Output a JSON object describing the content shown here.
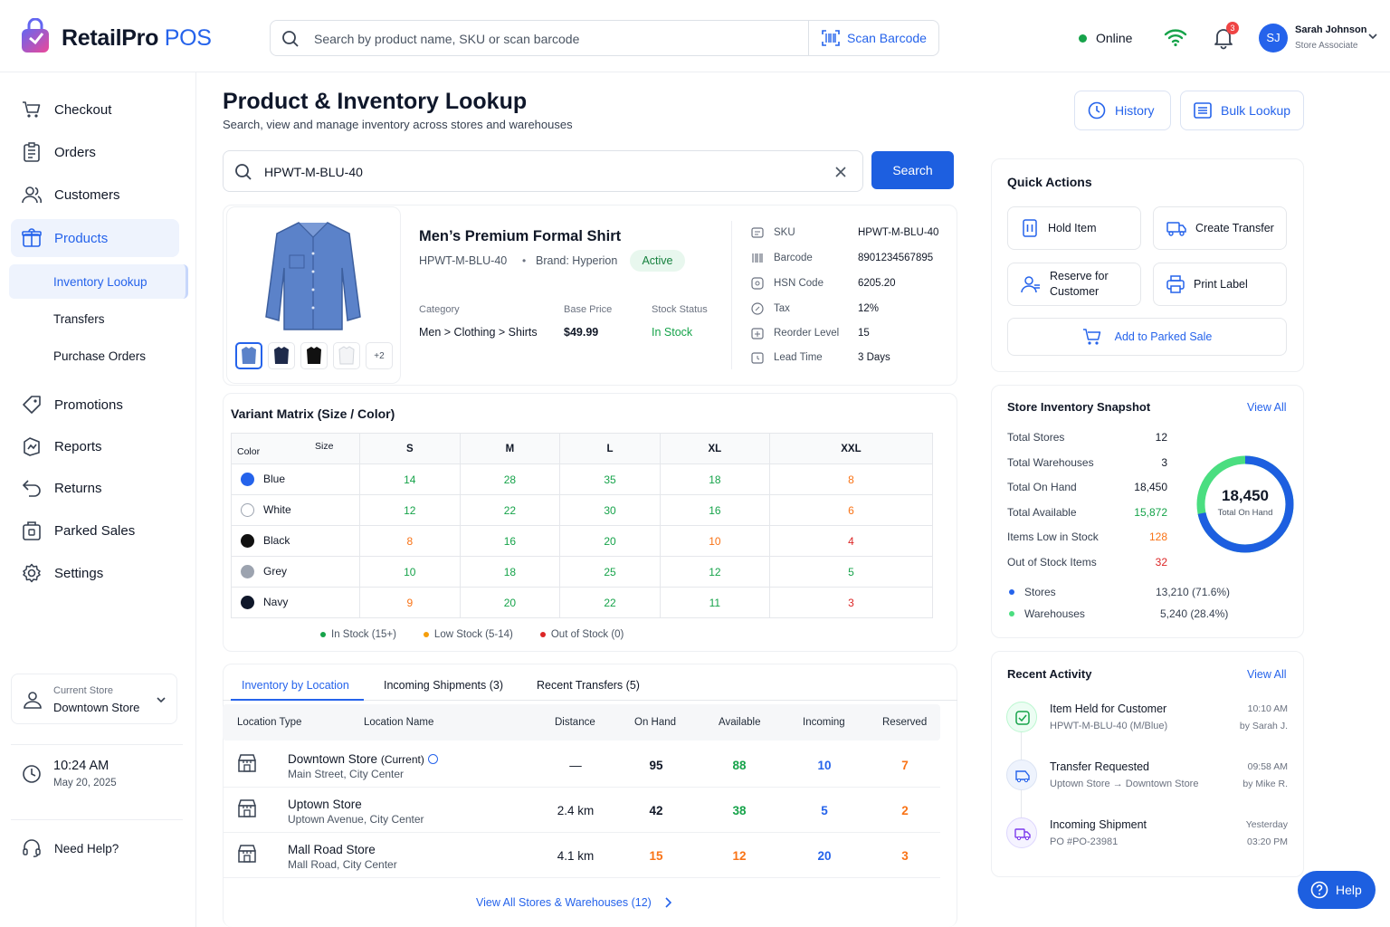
{
  "app": {
    "name": "RetailPro",
    "suffix": "POS"
  },
  "header": {
    "search_placeholder": "Search by product name, SKU or scan barcode",
    "scan_label": "Scan Barcode",
    "status": "Online",
    "notifications": "3",
    "user": {
      "initials": "SJ",
      "name": "Sarah Johnson",
      "role": "Store Associate"
    }
  },
  "sidebar": {
    "items": [
      {
        "label": "Checkout",
        "icon": "cart-icon"
      },
      {
        "label": "Orders",
        "icon": "clipboard-icon"
      },
      {
        "label": "Customers",
        "icon": "users-icon"
      },
      {
        "label": "Products",
        "icon": "box-icon"
      },
      {
        "label": "Promotions",
        "icon": "tag-icon"
      },
      {
        "label": "Reports",
        "icon": "chart-icon"
      },
      {
        "label": "Returns",
        "icon": "return-icon"
      },
      {
        "label": "Parked Sales",
        "icon": "parked-icon"
      },
      {
        "label": "Settings",
        "icon": "gear-icon"
      }
    ],
    "sub_items": [
      "Inventory Lookup",
      "Transfers",
      "Purchase Orders"
    ],
    "current_store_label": "Current Store",
    "current_store": "Downtown Store",
    "time": "10:24 AM",
    "date": "May 20, 2025",
    "help": "Need Help?"
  },
  "page": {
    "title": "Product & Inventory Lookup",
    "subtitle": "Search, view and manage inventory across stores and warehouses",
    "history": "History",
    "bulk": "Bulk Lookup",
    "search_value": "HPWT-M-BLU-40",
    "search_button": "Search"
  },
  "product": {
    "name": "Men’s Premium Formal Shirt",
    "sku": "HPWT-M-BLU-40",
    "brand": "Brand: Hyperion",
    "status": "Active",
    "more_images": "+2",
    "category_label": "Category",
    "category": "Men > Clothing > Shirts",
    "price_label": "Base Price",
    "price": "$49.99",
    "stock_label": "Stock Status",
    "stock": "In Stock",
    "details": [
      {
        "label": "SKU",
        "value": "HPWT-M-BLU-40"
      },
      {
        "label": "Barcode",
        "value": "8901234567895"
      },
      {
        "label": "HSN Code",
        "value": "6205.20"
      },
      {
        "label": "Tax",
        "value": "12%"
      },
      {
        "label": "Reorder Level",
        "value": "15"
      },
      {
        "label": "Lead Time",
        "value": "3 Days"
      }
    ]
  },
  "matrix": {
    "title": "Variant Matrix (Size / Color)",
    "size_label": "Size",
    "color_label": "Color",
    "sizes": [
      "S",
      "M",
      "L",
      "XL",
      "XXL"
    ],
    "rows": [
      {
        "color": "Blue",
        "hex": "#2563eb",
        "values": [
          "14",
          "28",
          "35",
          "18",
          "8"
        ],
        "levels": [
          "g",
          "g",
          "g",
          "g",
          "o"
        ]
      },
      {
        "color": "White",
        "hex": "#ffffff",
        "values": [
          "12",
          "22",
          "30",
          "16",
          "6"
        ],
        "levels": [
          "g",
          "g",
          "g",
          "g",
          "o"
        ]
      },
      {
        "color": "Black",
        "hex": "#111111",
        "values": [
          "8",
          "16",
          "20",
          "10",
          "4"
        ],
        "levels": [
          "o",
          "g",
          "g",
          "o",
          "r"
        ]
      },
      {
        "color": "Grey",
        "hex": "#9ca3af",
        "values": [
          "10",
          "18",
          "25",
          "12",
          "5"
        ],
        "levels": [
          "g",
          "g",
          "g",
          "g",
          "g"
        ]
      },
      {
        "color": "Navy",
        "hex": "#0f172a",
        "values": [
          "9",
          "20",
          "22",
          "11",
          "3"
        ],
        "levels": [
          "o",
          "g",
          "g",
          "g",
          "r"
        ]
      }
    ],
    "legend": [
      "In Stock (15+)",
      "Low Stock (5-14)",
      "Out of Stock (0)"
    ]
  },
  "tabs": [
    "Inventory by Location",
    "Incoming Shipments (3)",
    "Recent Transfers (5)"
  ],
  "locations": {
    "headers": [
      "Location Type",
      "Location Name",
      "Distance",
      "On Hand",
      "Available",
      "Incoming",
      "Reserved"
    ],
    "rows": [
      {
        "name": "Downtown Store",
        "tag": "(Current)",
        "address": "Main Street, City Center",
        "distance": "—",
        "on_hand": "95",
        "available": "88",
        "incoming": "10",
        "reserved": "7"
      },
      {
        "name": "Uptown Store",
        "tag": "",
        "address": "Uptown Avenue, City Center",
        "distance": "2.4 km",
        "on_hand": "42",
        "available": "38",
        "incoming": "5",
        "reserved": "2"
      },
      {
        "name": "Mall Road Store",
        "tag": "",
        "address": "Mall Road, City Center",
        "distance": "4.1 km",
        "on_hand": "15",
        "available": "12",
        "incoming": "20",
        "reserved": "3"
      }
    ],
    "view_all": "View All Stores & Warehouses (12)"
  },
  "quick_actions": {
    "title": "Quick Actions",
    "items": [
      "Hold Item",
      "Create Transfer",
      "Reserve for Customer",
      "Print Label"
    ],
    "parked": "Add to Parked Sale"
  },
  "snapshot": {
    "title": "Store Inventory Snapshot",
    "view_all": "View All",
    "rows": [
      {
        "label": "Total Stores",
        "value": "12"
      },
      {
        "label": "Total Warehouses",
        "value": "3"
      },
      {
        "label": "Total On Hand",
        "value": "18,450"
      },
      {
        "label": "Total Available",
        "value": "15,872"
      },
      {
        "label": "Items Low in Stock",
        "value": "128"
      },
      {
        "label": "Out of Stock Items",
        "value": "32"
      }
    ],
    "donut_value": "18,450",
    "donut_label": "Total On Hand",
    "split": [
      {
        "label": "Stores",
        "value": "13,210 (71.6%)",
        "fraction": 0.716
      },
      {
        "label": "Warehouses",
        "value": "5,240 (28.4%)",
        "fraction": 0.284
      }
    ]
  },
  "activity": {
    "title": "Recent Activity",
    "view_all": "View All",
    "items": [
      {
        "title": "Item Held for Customer",
        "sub": "HPWT-M-BLU-40 (M/Blue)",
        "time": "10:10 AM",
        "by": "by Sarah J."
      },
      {
        "title": "Transfer Requested",
        "sub": "Uptown Store → Downtown Store",
        "time": "09:58 AM",
        "by": "by Mike R."
      },
      {
        "title": "Incoming Shipment",
        "sub": "PO #PO-23981",
        "time": "Yesterday",
        "by": "03:20 PM"
      }
    ]
  },
  "help_button": "Help",
  "colors": {
    "accent": "#2563eb",
    "green": "#16a34a",
    "orange": "#f97316",
    "red": "#dc2626"
  }
}
